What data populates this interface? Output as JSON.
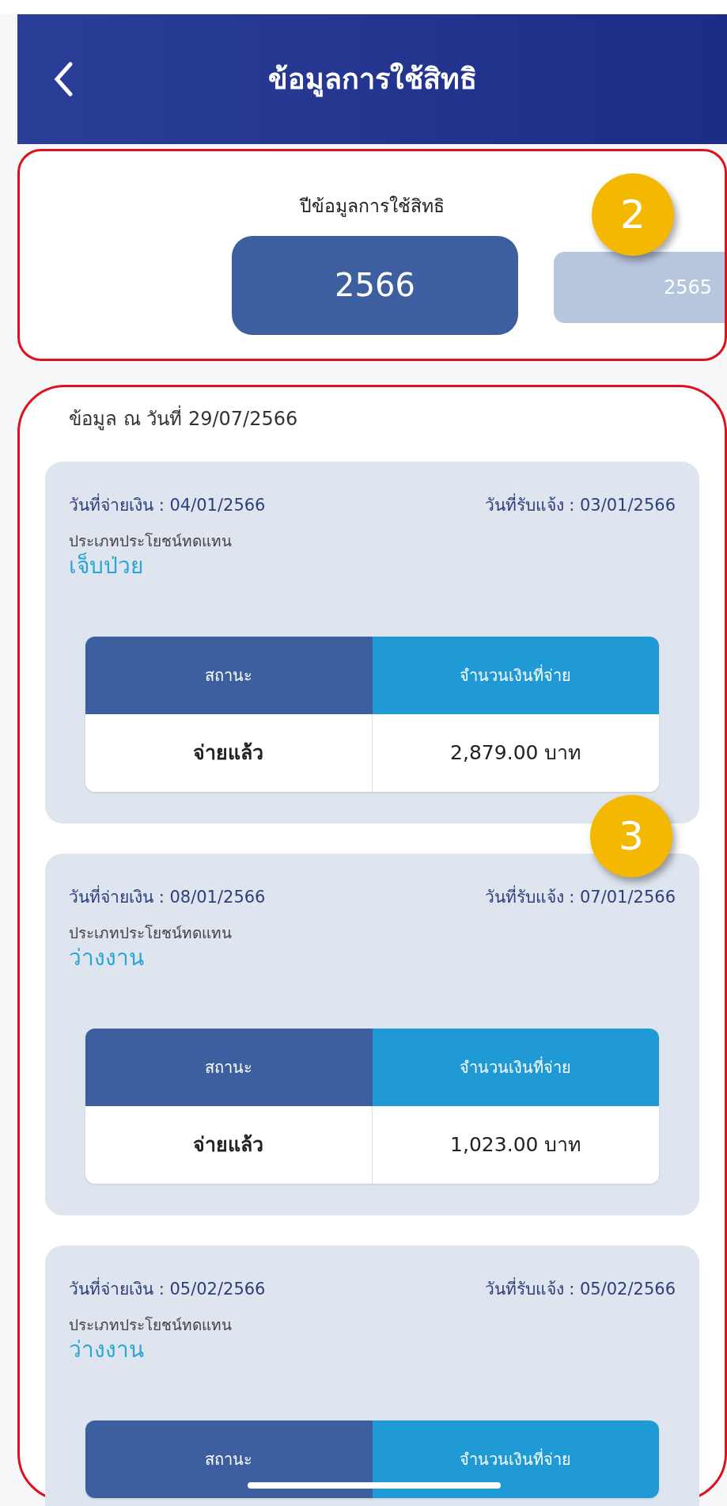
{
  "header": {
    "title": "ข้อมูลการใช้สิทธิ"
  },
  "year_picker": {
    "title": "ปีข้อมูลการใช้สิทธิ",
    "callout": "2",
    "years": [
      {
        "label": "2566",
        "selected": true
      },
      {
        "label": "2565",
        "selected": false
      }
    ]
  },
  "records": {
    "as_of": "ข้อมูล ณ วันที่ 29/07/2566",
    "callout": "3",
    "items": [
      {
        "payment_date": "วันที่จ่ายเงิน : 04/01/2566",
        "notice_date": "วันที่รับแจ้ง : 03/01/2566",
        "benefit_label": "ประเภทประโยชน์ทดแทน",
        "benefit": "เจ็บป่วย",
        "columns": [
          "สถานะ",
          "จำนวนเงินที่จ่าย"
        ],
        "row": [
          "จ่ายแล้ว",
          "2,879.00 บาท"
        ]
      },
      {
        "payment_date": "วันที่จ่ายเงิน : 08/01/2566",
        "notice_date": "วันที่รับแจ้ง : 07/01/2566",
        "benefit_label": "ประเภทประโยชน์ทดแทน",
        "benefit": "ว่างงาน",
        "columns": [
          "สถานะ",
          "จำนวนเงินที่จ่าย"
        ],
        "row": [
          "จ่ายแล้ว",
          "1,023.00 บาท"
        ]
      },
      {
        "payment_date": "วันที่จ่ายเงิน : 05/02/2566",
        "notice_date": "วันที่รับแจ้ง : 05/02/2566",
        "benefit_label": "ประเภทประโยชน์ทดแทน",
        "benefit": "ว่างงาน",
        "columns": [
          "สถานะ",
          "จำนวนเงินที่จ่าย"
        ]
      }
    ]
  }
}
